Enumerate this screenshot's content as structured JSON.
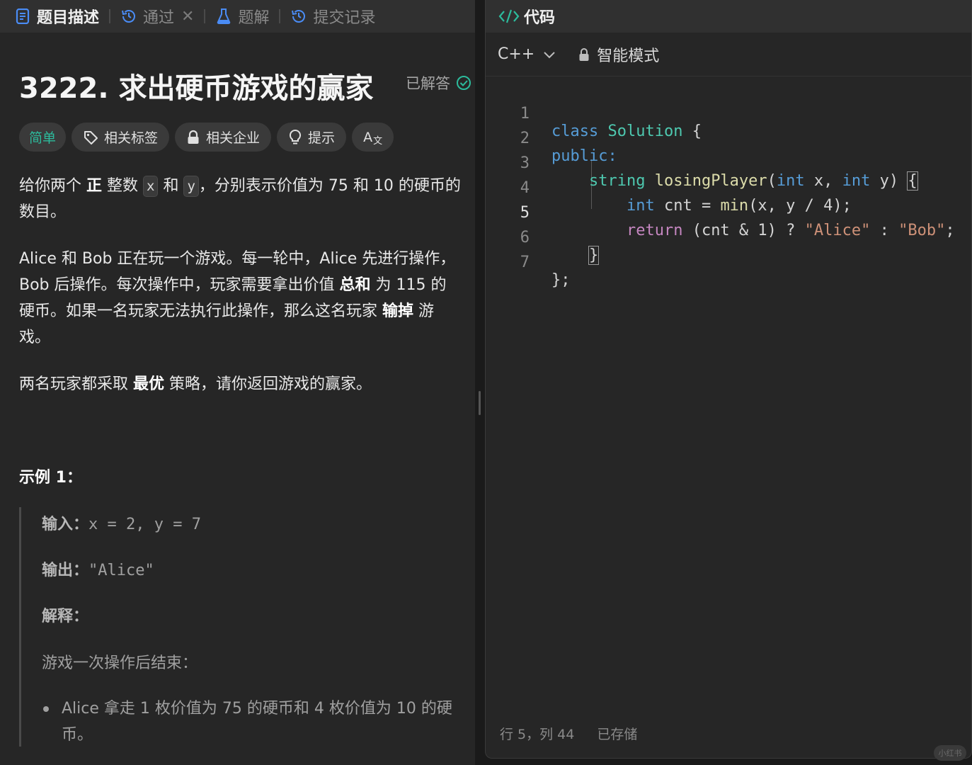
{
  "left_tabs": [
    {
      "label": "题目描述",
      "icon": "description-icon"
    },
    {
      "label": "通过",
      "icon": "history-icon"
    },
    {
      "label": "题解",
      "icon": "flask-icon"
    },
    {
      "label": "提交记录",
      "icon": "history-icon"
    }
  ],
  "problem": {
    "title": "3222. 求出硬币游戏的赢家",
    "status": "已解答",
    "chips": {
      "difficulty": "简单",
      "tags": "相关标签",
      "companies": "相关企业",
      "hint": "提示",
      "font": "A"
    },
    "p1": {
      "a": "给你两个 ",
      "b": "正",
      "c": " 整数 ",
      "x": "x",
      "d": " 和 ",
      "y": "y",
      "e": "，分别表示价值为 75 和 10 的硬币的数目。"
    },
    "p2": {
      "a": "Alice 和 Bob 正在玩一个游戏。每一轮中，Alice 先进行操作，Bob 后操作。每次操作中，玩家需要拿出价值 ",
      "b": "总和",
      "c": " 为 115 的硬币。如果一名玩家无法执行此操作，那么这名玩家 ",
      "d": "输掉",
      "e": " 游戏。"
    },
    "p3": {
      "a": "两名玩家都采取 ",
      "b": "最优",
      "c": " 策略，请你返回游戏的赢家。"
    },
    "example": {
      "title": "示例 1：",
      "input_label": "输入：",
      "input_value": "x = 2, y = 7",
      "output_label": "输出：",
      "output_value": "\"Alice\"",
      "explain_label": "解释：",
      "explain_text": "游戏一次操作后结束：",
      "bullet": "Alice 拿走 1 枚价值为 75 的硬币和 4 枚价值为 10 的硬币。"
    }
  },
  "code_panel": {
    "title": "代码",
    "language": "C++",
    "mode": "智能模式",
    "status_position": "行 5，列 44",
    "status_saved": "已存储",
    "line_numbers": [
      "1",
      "2",
      "3",
      "4",
      "5",
      "6",
      "7"
    ],
    "tokens": {
      "l1_kw": "class",
      "l1_name": "Solution",
      "l1_rest": " {",
      "l2_kw": "public:",
      "l3_type": "string",
      "l3_fn": "losingPlayer",
      "l3_open": "(",
      "l3_int1": "int",
      "l3_x": " x, ",
      "l3_int2": "int",
      "l3_y": " y) ",
      "l3_brace": "{",
      "l4_int": "int",
      "l4_a": " cnt = ",
      "l4_fn": "min",
      "l4_b": "(x, y / 4);",
      "l5_ret": "return",
      "l5_a": " (cnt & 1) ? ",
      "l5_s1": "\"Alice\"",
      "l5_b": " : ",
      "l5_s2": "\"Bob\"",
      "l5_c": ";",
      "l6_brace": "}",
      "l7": "};"
    }
  },
  "watermark": "小红书",
  "colors": {
    "easy": "#2cbb9c",
    "accepted": "#2cbb9c",
    "keyword": "#569cd6",
    "type": "#4ec9b0",
    "function": "#dcdcaa",
    "string": "#ce9178",
    "control": "#c586c0"
  }
}
